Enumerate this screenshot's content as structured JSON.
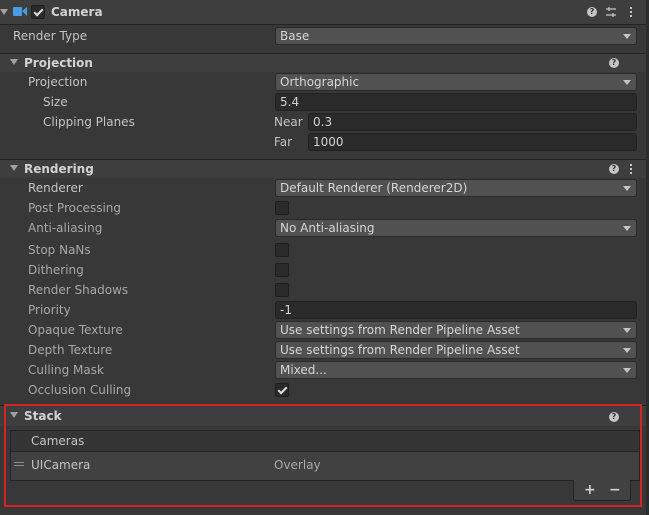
{
  "component": {
    "title": "Camera",
    "enabled": true,
    "render_type_label": "Render Type",
    "render_type_value": "Base"
  },
  "projection": {
    "header": "Projection",
    "projection_label": "Projection",
    "projection_value": "Orthographic",
    "size_label": "Size",
    "size_value": "5.4",
    "clipping_label": "Clipping Planes",
    "near_label": "Near",
    "near_value": "0.3",
    "far_label": "Far",
    "far_value": "1000"
  },
  "rendering": {
    "header": "Rendering",
    "renderer_label": "Renderer",
    "renderer_value": "Default Renderer (Renderer2D)",
    "post_processing_label": "Post Processing",
    "post_processing": false,
    "anti_aliasing_label": "Anti-aliasing",
    "anti_aliasing_value": "No Anti-aliasing",
    "stop_nans_label": "Stop NaNs",
    "stop_nans": false,
    "dithering_label": "Dithering",
    "dithering": false,
    "render_shadows_label": "Render Shadows",
    "render_shadows": false,
    "priority_label": "Priority",
    "priority_value": "-1",
    "opaque_texture_label": "Opaque Texture",
    "opaque_texture_value": "Use settings from Render Pipeline Asset",
    "depth_texture_label": "Depth Texture",
    "depth_texture_value": "Use settings from Render Pipeline Asset",
    "culling_mask_label": "Culling Mask",
    "culling_mask_value": "Mixed...",
    "occlusion_culling_label": "Occlusion Culling",
    "occlusion_culling": true
  },
  "stack": {
    "header": "Stack",
    "list_header": "Cameras",
    "items": [
      {
        "name": "UICamera",
        "type": "Overlay"
      }
    ],
    "add_label": "+",
    "remove_label": "−"
  },
  "icons": {
    "help": "help-icon",
    "presets": "presets-icon",
    "menu": "kebab-menu-icon",
    "camera": "camera-icon"
  },
  "colors": {
    "highlight_box": "#d42424",
    "panel_bg": "#383838",
    "header_bg": "#3e3e3e"
  }
}
